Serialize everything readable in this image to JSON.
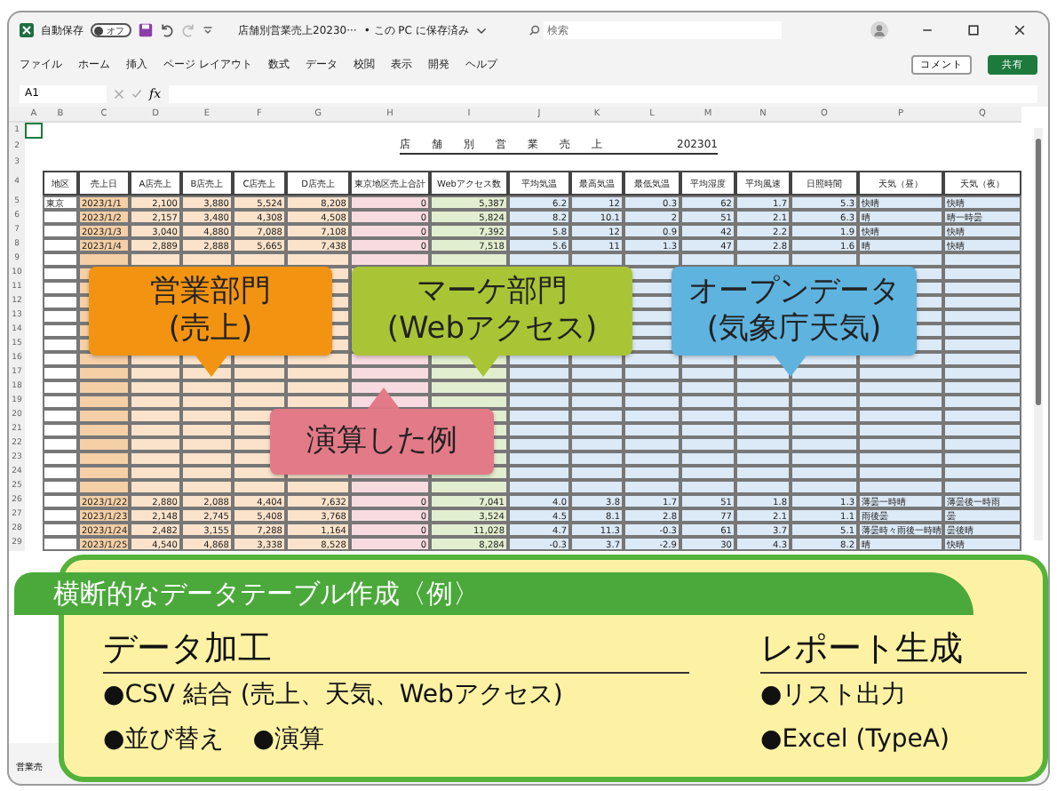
{
  "title_bar": {
    "autosave_label": "自動保存",
    "autosave_toggle": {
      "label": "オフ",
      "on": false
    },
    "filename": "店舗別営業売上20230···",
    "save_status": "• この PC に保存済み",
    "search": {
      "placeholder": "検索"
    }
  },
  "menu": {
    "items": [
      "ファイル",
      "ホーム",
      "挿入",
      "ページ レイアウト",
      "数式",
      "データ",
      "校閲",
      "表示",
      "開発",
      "ヘルプ"
    ],
    "comment_button": "コメント",
    "share_button": "共有"
  },
  "formula_bar": {
    "cell_ref": "A1",
    "fx": "fx"
  },
  "sheet": {
    "column_letters": [
      "A",
      "B",
      "C",
      "D",
      "E",
      "F",
      "G",
      "H",
      "I",
      "J",
      "K",
      "L",
      "M",
      "N",
      "O",
      "P",
      "Q"
    ],
    "top_row_numbers": [
      "1",
      "2",
      "3",
      "4"
    ],
    "title": "店舗別営業売上",
    "period": "202301",
    "headers": [
      "地区",
      "売上日",
      "A店売上",
      "B店売上",
      "C店売上",
      "D店売上",
      "東京地区売上合計",
      "Webアクセス数",
      "平均気温",
      "最高気温",
      "最低気温",
      "平均湿度",
      "平均風速",
      "日照時間",
      "天気（昼）",
      "天気（夜）"
    ],
    "rows": [
      {
        "number": "5",
        "cells": [
          "東京",
          "2023/1/1",
          "2,100",
          "3,880",
          "5,524",
          "8,208",
          "0",
          "5,387",
          "6.2",
          "12",
          "0.3",
          "62",
          "1.7",
          "5.3",
          "快晴",
          "快晴"
        ]
      },
      {
        "number": "6",
        "cells": [
          "",
          "2023/1/2",
          "2,157",
          "3,480",
          "4,308",
          "4,508",
          "0",
          "5,824",
          "8.2",
          "10.1",
          "2",
          "51",
          "2.1",
          "6.3",
          "晴",
          "晴一時曇"
        ]
      },
      {
        "number": "7",
        "cells": [
          "",
          "2023/1/3",
          "3,040",
          "4,880",
          "7,088",
          "7,108",
          "0",
          "7,392",
          "5.8",
          "12",
          "0.9",
          "42",
          "2.2",
          "1.9",
          "快晴",
          "快晴"
        ]
      },
      {
        "number": "8",
        "cells": [
          "",
          "2023/1/4",
          "2,889",
          "2,888",
          "5,665",
          "7,438",
          "0",
          "7,518",
          "5.6",
          "11",
          "1.3",
          "47",
          "2.8",
          "1.6",
          "晴",
          "快晴"
        ]
      },
      {
        "number": "9"
      },
      {
        "number": "10"
      },
      {
        "number": "11"
      },
      {
        "number": "12"
      },
      {
        "number": "13"
      },
      {
        "number": "14"
      },
      {
        "number": "15"
      },
      {
        "number": "16"
      },
      {
        "number": "17"
      },
      {
        "number": "18"
      },
      {
        "number": "19"
      },
      {
        "number": "20"
      },
      {
        "number": "21"
      },
      {
        "number": "22"
      },
      {
        "number": "23"
      },
      {
        "number": "24"
      },
      {
        "number": "25"
      },
      {
        "number": "26",
        "cells": [
          "",
          "2023/1/22",
          "2,880",
          "2,088",
          "4,404",
          "7,632",
          "0",
          "7,041",
          "4.0",
          "3.8",
          "1.7",
          "51",
          "1.8",
          "1.3",
          "薄曇一時晴",
          "薄曇後一時雨"
        ]
      },
      {
        "number": "27",
        "cells": [
          "",
          "2023/1/23",
          "2,148",
          "2,745",
          "5,408",
          "3,768",
          "0",
          "3,524",
          "4.5",
          "8.1",
          "2.8",
          "77",
          "2.1",
          "1.1",
          "雨後曇",
          "曇"
        ]
      },
      {
        "number": "28",
        "cells": [
          "",
          "2023/1/24",
          "2,482",
          "3,155",
          "7,288",
          "1,164",
          "0",
          "11,028",
          "4.7",
          "11.3",
          "-0.3",
          "61",
          "3.7",
          "5.1",
          "薄曇時々雨後一時晴",
          "曇後晴"
        ]
      },
      {
        "number": "29",
        "cells": [
          "",
          "2023/1/25",
          "4,540",
          "4,868",
          "3,338",
          "8,528",
          "0",
          "8,284",
          "-0.3",
          "3.7",
          "-2.9",
          "30",
          "4.3",
          "8.2",
          "晴",
          "快晴"
        ]
      }
    ],
    "sheet_tab": "営業売"
  },
  "callouts": [
    {
      "kind": "down",
      "lines": [
        "営業部門",
        "(売上)"
      ],
      "color": "#f29412"
    },
    {
      "kind": "down",
      "lines": [
        "マーケ部門",
        "(Webアクセス)"
      ],
      "color": "#a9c536"
    },
    {
      "kind": "down",
      "lines": [
        "オープンデータ",
        "(気象庁天気)"
      ],
      "color": "#5fb3df"
    },
    {
      "kind": "up",
      "lines": [
        "演算した例"
      ],
      "color": "#e27a88"
    }
  ],
  "summary": {
    "title": "横断的なデータテーブル作成〈例〉",
    "sections": [
      {
        "heading": "データ加工",
        "lines": [
          [
            "●CSV 結合 (売上、天気、Webアクセス)"
          ],
          [
            "●並び替え",
            "●演算"
          ]
        ]
      },
      {
        "heading": "レポート生成",
        "lines": [
          [
            "●リスト出力"
          ],
          [
            "●Excel (TypeA)"
          ]
        ]
      }
    ]
  }
}
